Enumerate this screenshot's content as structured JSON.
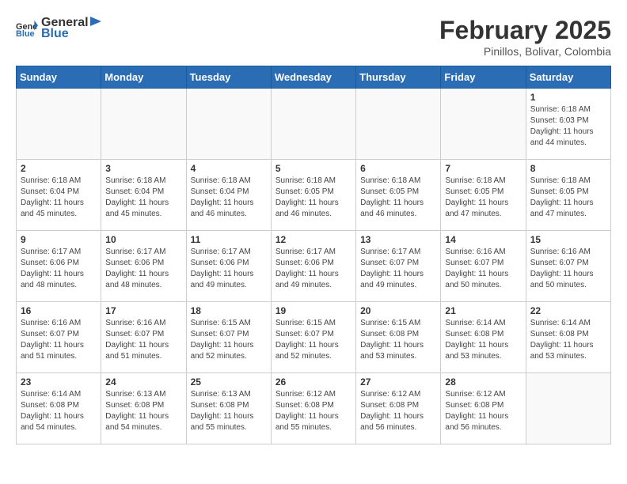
{
  "header": {
    "logo": {
      "general": "General",
      "blue": "Blue"
    },
    "title": "February 2025",
    "location": "Pinillos, Bolivar, Colombia"
  },
  "days_of_week": [
    "Sunday",
    "Monday",
    "Tuesday",
    "Wednesday",
    "Thursday",
    "Friday",
    "Saturday"
  ],
  "weeks": [
    [
      {
        "day": "",
        "info": ""
      },
      {
        "day": "",
        "info": ""
      },
      {
        "day": "",
        "info": ""
      },
      {
        "day": "",
        "info": ""
      },
      {
        "day": "",
        "info": ""
      },
      {
        "day": "",
        "info": ""
      },
      {
        "day": "1",
        "info": "Sunrise: 6:18 AM\nSunset: 6:03 PM\nDaylight: 11 hours and 44 minutes."
      }
    ],
    [
      {
        "day": "2",
        "info": "Sunrise: 6:18 AM\nSunset: 6:04 PM\nDaylight: 11 hours and 45 minutes."
      },
      {
        "day": "3",
        "info": "Sunrise: 6:18 AM\nSunset: 6:04 PM\nDaylight: 11 hours and 45 minutes."
      },
      {
        "day": "4",
        "info": "Sunrise: 6:18 AM\nSunset: 6:04 PM\nDaylight: 11 hours and 46 minutes."
      },
      {
        "day": "5",
        "info": "Sunrise: 6:18 AM\nSunset: 6:05 PM\nDaylight: 11 hours and 46 minutes."
      },
      {
        "day": "6",
        "info": "Sunrise: 6:18 AM\nSunset: 6:05 PM\nDaylight: 11 hours and 46 minutes."
      },
      {
        "day": "7",
        "info": "Sunrise: 6:18 AM\nSunset: 6:05 PM\nDaylight: 11 hours and 47 minutes."
      },
      {
        "day": "8",
        "info": "Sunrise: 6:18 AM\nSunset: 6:05 PM\nDaylight: 11 hours and 47 minutes."
      }
    ],
    [
      {
        "day": "9",
        "info": "Sunrise: 6:17 AM\nSunset: 6:06 PM\nDaylight: 11 hours and 48 minutes."
      },
      {
        "day": "10",
        "info": "Sunrise: 6:17 AM\nSunset: 6:06 PM\nDaylight: 11 hours and 48 minutes."
      },
      {
        "day": "11",
        "info": "Sunrise: 6:17 AM\nSunset: 6:06 PM\nDaylight: 11 hours and 49 minutes."
      },
      {
        "day": "12",
        "info": "Sunrise: 6:17 AM\nSunset: 6:06 PM\nDaylight: 11 hours and 49 minutes."
      },
      {
        "day": "13",
        "info": "Sunrise: 6:17 AM\nSunset: 6:07 PM\nDaylight: 11 hours and 49 minutes."
      },
      {
        "day": "14",
        "info": "Sunrise: 6:16 AM\nSunset: 6:07 PM\nDaylight: 11 hours and 50 minutes."
      },
      {
        "day": "15",
        "info": "Sunrise: 6:16 AM\nSunset: 6:07 PM\nDaylight: 11 hours and 50 minutes."
      }
    ],
    [
      {
        "day": "16",
        "info": "Sunrise: 6:16 AM\nSunset: 6:07 PM\nDaylight: 11 hours and 51 minutes."
      },
      {
        "day": "17",
        "info": "Sunrise: 6:16 AM\nSunset: 6:07 PM\nDaylight: 11 hours and 51 minutes."
      },
      {
        "day": "18",
        "info": "Sunrise: 6:15 AM\nSunset: 6:07 PM\nDaylight: 11 hours and 52 minutes."
      },
      {
        "day": "19",
        "info": "Sunrise: 6:15 AM\nSunset: 6:07 PM\nDaylight: 11 hours and 52 minutes."
      },
      {
        "day": "20",
        "info": "Sunrise: 6:15 AM\nSunset: 6:08 PM\nDaylight: 11 hours and 53 minutes."
      },
      {
        "day": "21",
        "info": "Sunrise: 6:14 AM\nSunset: 6:08 PM\nDaylight: 11 hours and 53 minutes."
      },
      {
        "day": "22",
        "info": "Sunrise: 6:14 AM\nSunset: 6:08 PM\nDaylight: 11 hours and 53 minutes."
      }
    ],
    [
      {
        "day": "23",
        "info": "Sunrise: 6:14 AM\nSunset: 6:08 PM\nDaylight: 11 hours and 54 minutes."
      },
      {
        "day": "24",
        "info": "Sunrise: 6:13 AM\nSunset: 6:08 PM\nDaylight: 11 hours and 54 minutes."
      },
      {
        "day": "25",
        "info": "Sunrise: 6:13 AM\nSunset: 6:08 PM\nDaylight: 11 hours and 55 minutes."
      },
      {
        "day": "26",
        "info": "Sunrise: 6:12 AM\nSunset: 6:08 PM\nDaylight: 11 hours and 55 minutes."
      },
      {
        "day": "27",
        "info": "Sunrise: 6:12 AM\nSunset: 6:08 PM\nDaylight: 11 hours and 56 minutes."
      },
      {
        "day": "28",
        "info": "Sunrise: 6:12 AM\nSunset: 6:08 PM\nDaylight: 11 hours and 56 minutes."
      },
      {
        "day": "",
        "info": ""
      }
    ]
  ]
}
